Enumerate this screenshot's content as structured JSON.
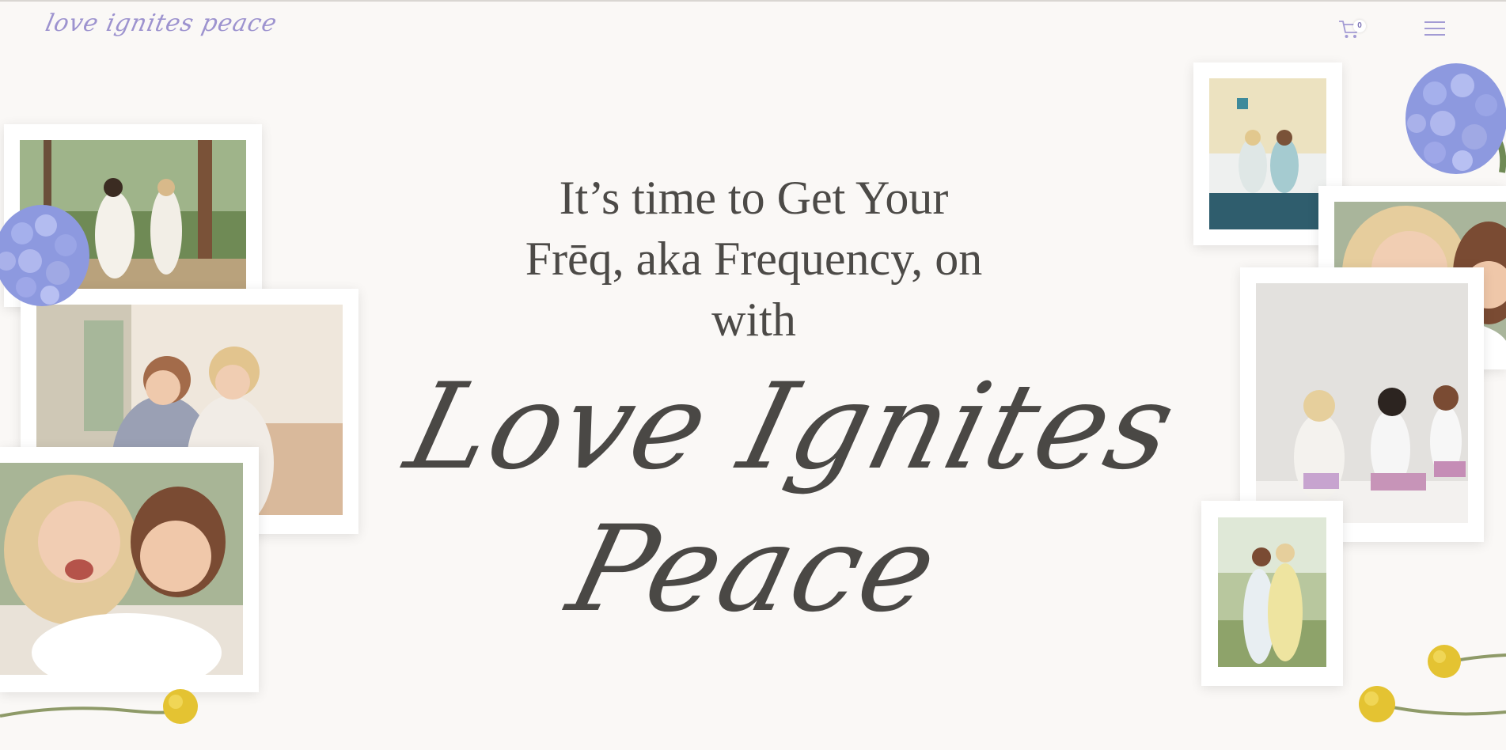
{
  "header": {
    "logo_text": "love ignites peace",
    "cart_count": "0",
    "cart_icon": "shopping-cart-icon",
    "menu_icon": "hamburger-menu-icon"
  },
  "hero": {
    "headline_line1": "It’s time to Get Your",
    "headline_line2": "Frēq, aka Frequency, on",
    "headline_line3": "with",
    "script_line1": "Love Ignites",
    "script_line2": "Peace"
  },
  "colors": {
    "background": "#faf8f6",
    "text": "#4a4845",
    "accent_lavender": "#9d93cf",
    "hydrangea": "#8f9be0",
    "billy_button": "#e8c938"
  }
}
